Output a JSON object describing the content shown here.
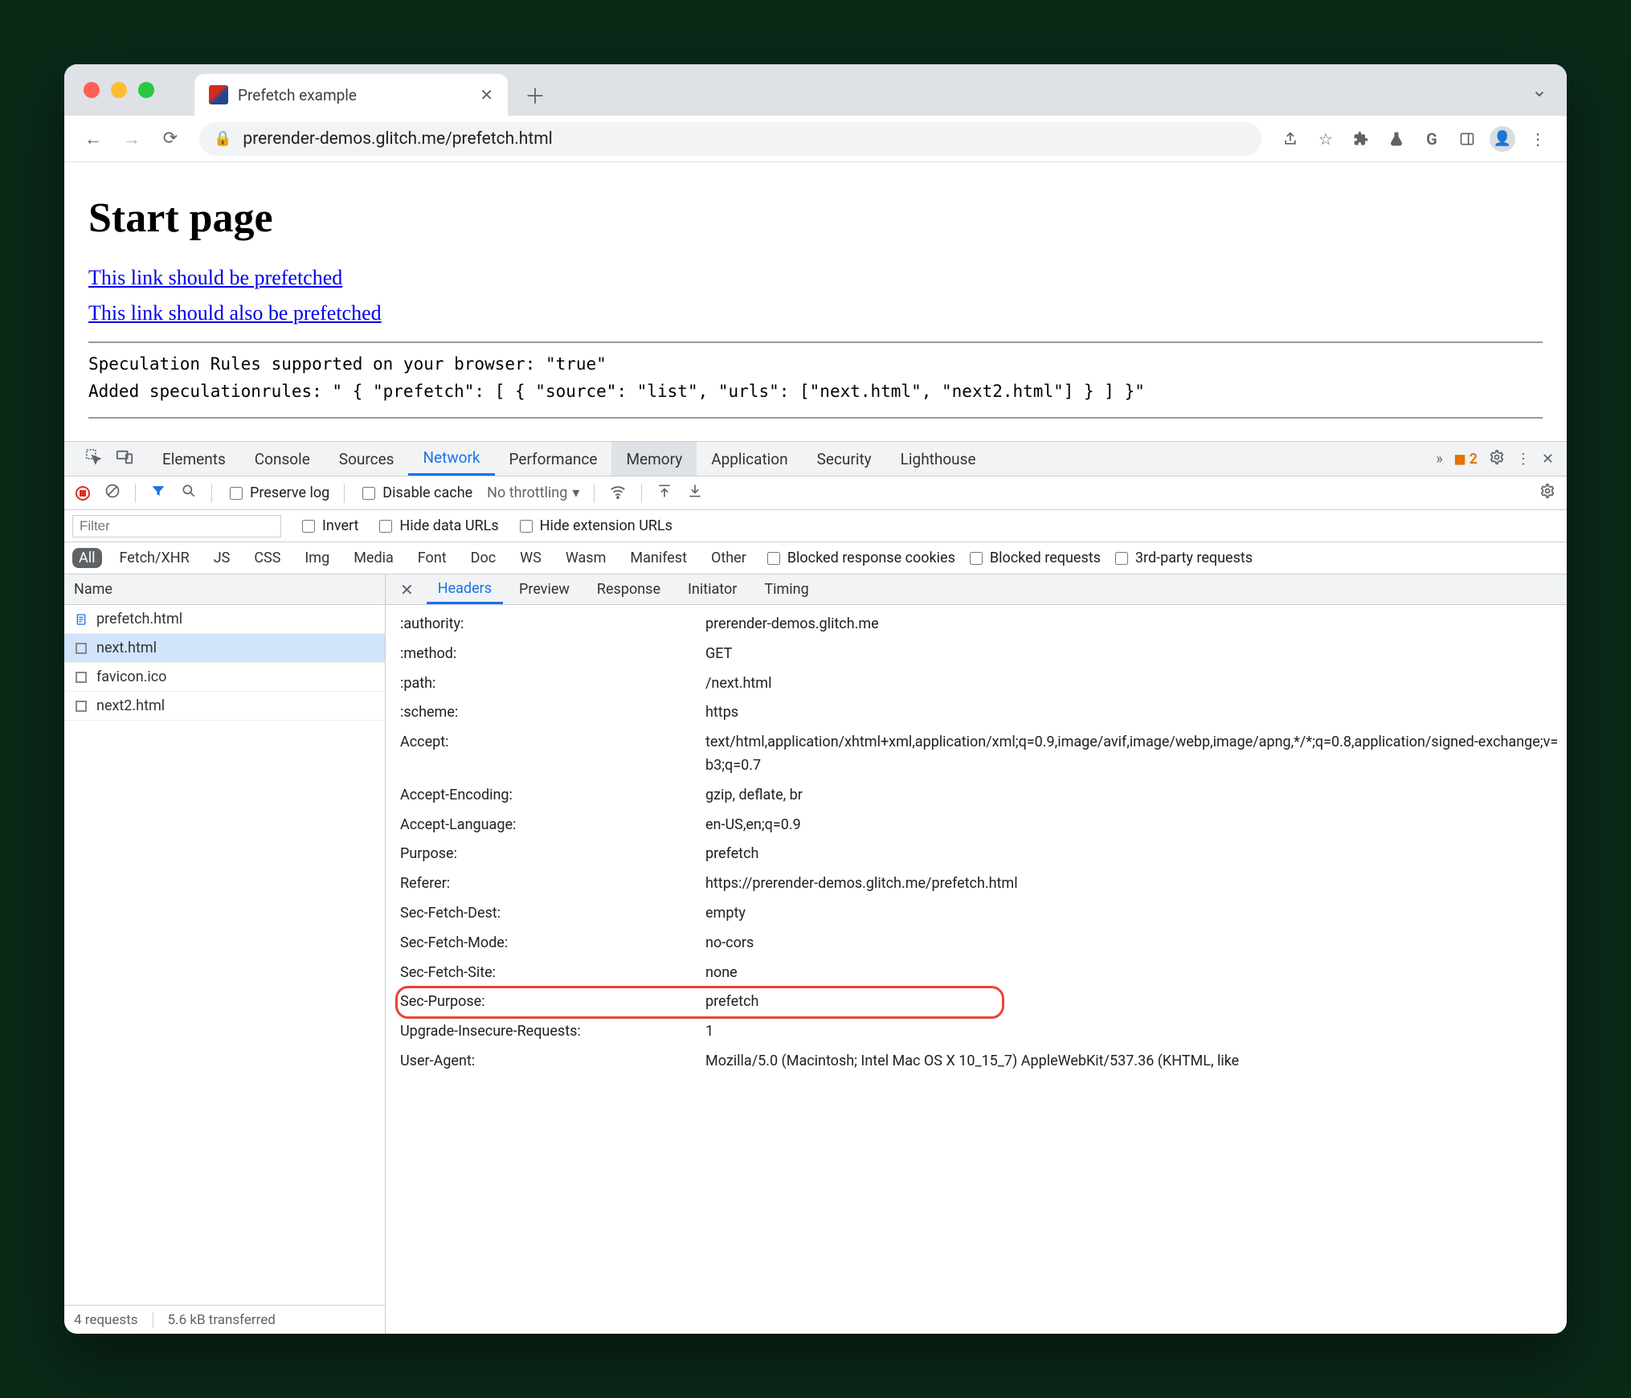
{
  "browser": {
    "tab_title": "Prefetch example",
    "url": "prerender-demos.glitch.me/prefetch.html"
  },
  "page": {
    "heading": "Start page",
    "link1": "This link should be prefetched",
    "link2": "This link should also be prefetched",
    "status1": "Speculation Rules supported on your browser: \"true\"",
    "status2": "Added speculationrules: \" { \"prefetch\": [ { \"source\": \"list\", \"urls\": [\"next.html\", \"next2.html\"] } ] }\""
  },
  "devtools": {
    "tabs": [
      "Elements",
      "Console",
      "Sources",
      "Network",
      "Performance",
      "Memory",
      "Application",
      "Security",
      "Lighthouse"
    ],
    "active_tab": "Network",
    "more_glyph": "»",
    "warnings": "2",
    "toolbar": {
      "preserve_log": "Preserve log",
      "disable_cache": "Disable cache",
      "throttling": "No throttling"
    },
    "filter": {
      "placeholder": "Filter",
      "invert": "Invert",
      "hide_data": "Hide data URLs",
      "hide_ext": "Hide extension URLs"
    },
    "types": [
      "All",
      "Fetch/XHR",
      "JS",
      "CSS",
      "Img",
      "Media",
      "Font",
      "Doc",
      "WS",
      "Wasm",
      "Manifest",
      "Other"
    ],
    "type_checks": {
      "blocked_cookies": "Blocked response cookies",
      "blocked_req": "Blocked requests",
      "third_party": "3rd-party requests"
    },
    "req_header": "Name",
    "requests": [
      {
        "name": "prefetch.html",
        "icon": "doc"
      },
      {
        "name": "next.html",
        "icon": "box",
        "selected": true
      },
      {
        "name": "favicon.ico",
        "icon": "box"
      },
      {
        "name": "next2.html",
        "icon": "box"
      }
    ],
    "summary": {
      "count": "4 requests",
      "xfer": "5.6 kB transferred"
    },
    "detail_tabs": [
      "Headers",
      "Preview",
      "Response",
      "Initiator",
      "Timing"
    ],
    "headers": [
      {
        "k": ":authority:",
        "v": "prerender-demos.glitch.me"
      },
      {
        "k": ":method:",
        "v": "GET"
      },
      {
        "k": ":path:",
        "v": "/next.html"
      },
      {
        "k": ":scheme:",
        "v": "https"
      },
      {
        "k": "Accept:",
        "v": "text/html,application/xhtml+xml,application/xml;q=0.9,image/avif,image/webp,image/apng,*/*;q=0.8,application/signed-exchange;v=b3;q=0.7"
      },
      {
        "k": "Accept-Encoding:",
        "v": "gzip, deflate, br"
      },
      {
        "k": "Accept-Language:",
        "v": "en-US,en;q=0.9"
      },
      {
        "k": "Purpose:",
        "v": "prefetch"
      },
      {
        "k": "Referer:",
        "v": "https://prerender-demos.glitch.me/prefetch.html"
      },
      {
        "k": "Sec-Fetch-Dest:",
        "v": "empty"
      },
      {
        "k": "Sec-Fetch-Mode:",
        "v": "no-cors"
      },
      {
        "k": "Sec-Fetch-Site:",
        "v": "none"
      },
      {
        "k": "Sec-Purpose:",
        "v": "prefetch",
        "highlight": true
      },
      {
        "k": "Upgrade-Insecure-Requests:",
        "v": "1"
      },
      {
        "k": "User-Agent:",
        "v": "Mozilla/5.0 (Macintosh; Intel Mac OS X 10_15_7) AppleWebKit/537.36 (KHTML, like"
      }
    ]
  }
}
